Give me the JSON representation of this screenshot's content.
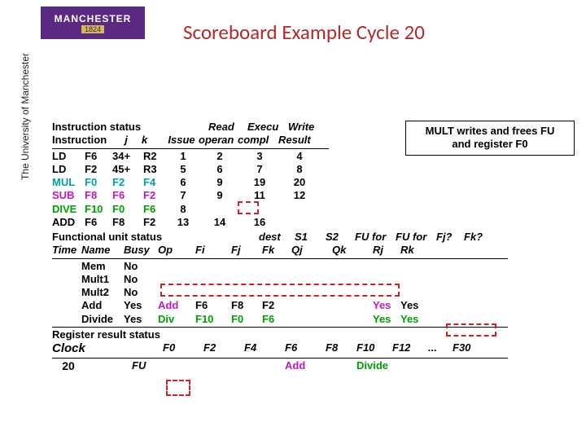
{
  "logo": {
    "name": "MANCHESTER",
    "year": "1824"
  },
  "sidebar": "The University of Manchester",
  "title": "Scoreboard Example Cycle 20",
  "callout_line1": "MULT writes and frees FU",
  "callout_line2": "and register F0",
  "instr_status_label": "Instruction status",
  "instr_hdr": {
    "instr": "Instruction",
    "j": "j",
    "k": "k",
    "issue": "Issue",
    "read": "Read operan",
    "exec": "Execu compl",
    "write": "Write Result"
  },
  "instr_rows": [
    {
      "op": "LD",
      "rd": "F6",
      "j": "34+",
      "k": "R2",
      "issue": "1",
      "read": "2",
      "exec": "3",
      "write": "4"
    },
    {
      "op": "LD",
      "rd": "F2",
      "j": "45+",
      "k": "R3",
      "issue": "5",
      "read": "6",
      "exec": "7",
      "write": "8"
    },
    {
      "op": "MUL",
      "rd": "F0",
      "j": "F2",
      "k": "F4",
      "issue": "6",
      "read": "9",
      "exec": "19",
      "write": "20"
    },
    {
      "op": "SUB",
      "rd": "F8",
      "j": "F6",
      "k": "F2",
      "issue": "7",
      "read": "9",
      "exec": "11",
      "write": "12"
    },
    {
      "op": "DIVE",
      "rd": "F10",
      "j": "F0",
      "k": "F6",
      "issue": "8",
      "read": "",
      "exec": "",
      "write": ""
    },
    {
      "op": "ADD",
      "rd": "F6",
      "j": "F8",
      "k": "F2",
      "issue": "13",
      "read": "14",
      "exec": "16",
      "write": ""
    }
  ],
  "fu_status_label": "Functional unit status",
  "fu_hdr": {
    "time": "Time",
    "name": "Name",
    "busy": "Busy",
    "op": "Op",
    "dest": "dest Fi",
    "s1": "S1 Fj",
    "s2": "S2 Fk",
    "fuj": "FU for Qj",
    "fuk": "FU for Qk",
    "fjq": "Fj? Rj",
    "fkq": "Fk? Rk"
  },
  "fu_rows": [
    {
      "time": "",
      "name": "Mem",
      "busy": "No",
      "op": "",
      "fi": "",
      "fj": "",
      "fk": "",
      "qj": "",
      "qk": "",
      "rj": "",
      "rk": ""
    },
    {
      "time": "",
      "name": "Mult1",
      "busy": "No",
      "op": "",
      "fi": "",
      "fj": "",
      "fk": "",
      "qj": "",
      "qk": "",
      "rj": "",
      "rk": ""
    },
    {
      "time": "",
      "name": "Mult2",
      "busy": "No",
      "op": "",
      "fi": "",
      "fj": "",
      "fk": "",
      "qj": "",
      "qk": "",
      "rj": "",
      "rk": ""
    },
    {
      "time": "",
      "name": "Add",
      "busy": "Yes",
      "op": "Add",
      "fi": "F6",
      "fj": "F8",
      "fk": "F2",
      "qj": "",
      "qk": "",
      "rj": "Yes",
      "rk": "Yes"
    },
    {
      "time": "",
      "name": "Divide",
      "busy": "Yes",
      "op": "Div",
      "fi": "F10",
      "fj": "F0",
      "fk": "F6",
      "qj": "",
      "qk": "",
      "rj": "Yes",
      "rk": "Yes"
    }
  ],
  "reg_status_label": "Register result status",
  "clock_label": "Clock",
  "clock_value": "20",
  "fu_label": "FU",
  "reg_hdr": [
    "F0",
    "F2",
    "F4",
    "F6",
    "F8",
    "F10",
    "F12",
    "...",
    "F30"
  ],
  "reg_vals": [
    "",
    "",
    "",
    "Add",
    "",
    "Divide",
    "",
    "",
    ""
  ]
}
